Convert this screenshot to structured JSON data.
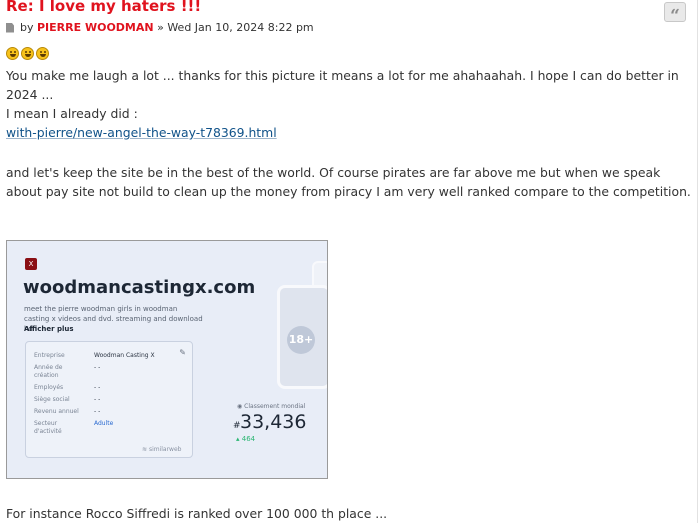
{
  "post": {
    "title": "Re: I love my haters !!!",
    "by_label": "by",
    "author": "PIERRE WOODMAN",
    "date_sep": "»",
    "date": "Wed Jan 10, 2024 8:22 pm",
    "quote_glyph": "“"
  },
  "body": {
    "paragraph1": "You make me laugh a lot ... thanks for this picture it means a lot for me ahahaahah. I hope I can do better in 2024 ...",
    "paragraph2": "I mean I already did :",
    "link": "with-pierre/new-angel-the-way-t78369.html",
    "paragraph3": "and let's keep the site be in the best of the world. Of course pirates are far above me but when we speak about pay site not build to clean up the money from piracy I am very well ranked compare to the competition.",
    "paragraph4": "For instance Rocco Siffredi is ranked over 100 000 th place ..."
  },
  "screenshot": {
    "logo": "X",
    "domain": "woodmancastingx.com",
    "description": "meet the pierre woodman girls in woodman casting x videos and dvd. streaming and download hd",
    "more": "Afficher plus",
    "rows": [
      {
        "label": "Entreprise",
        "value": "Woodman Casting X"
      },
      {
        "label": "Année de création",
        "value": "- -"
      },
      {
        "label": "Employés",
        "value": "- -"
      },
      {
        "label": "Siège social",
        "value": "- -"
      },
      {
        "label": "Revenu annuel",
        "value": "- -"
      },
      {
        "label": "Secteur d'activité",
        "value": "Adulte"
      }
    ],
    "brand": "similarweb",
    "age_badge": "18+",
    "rank_label": "Classement mondial",
    "rank_hash": "#",
    "rank_value": "33,436",
    "rank_delta": "464"
  }
}
